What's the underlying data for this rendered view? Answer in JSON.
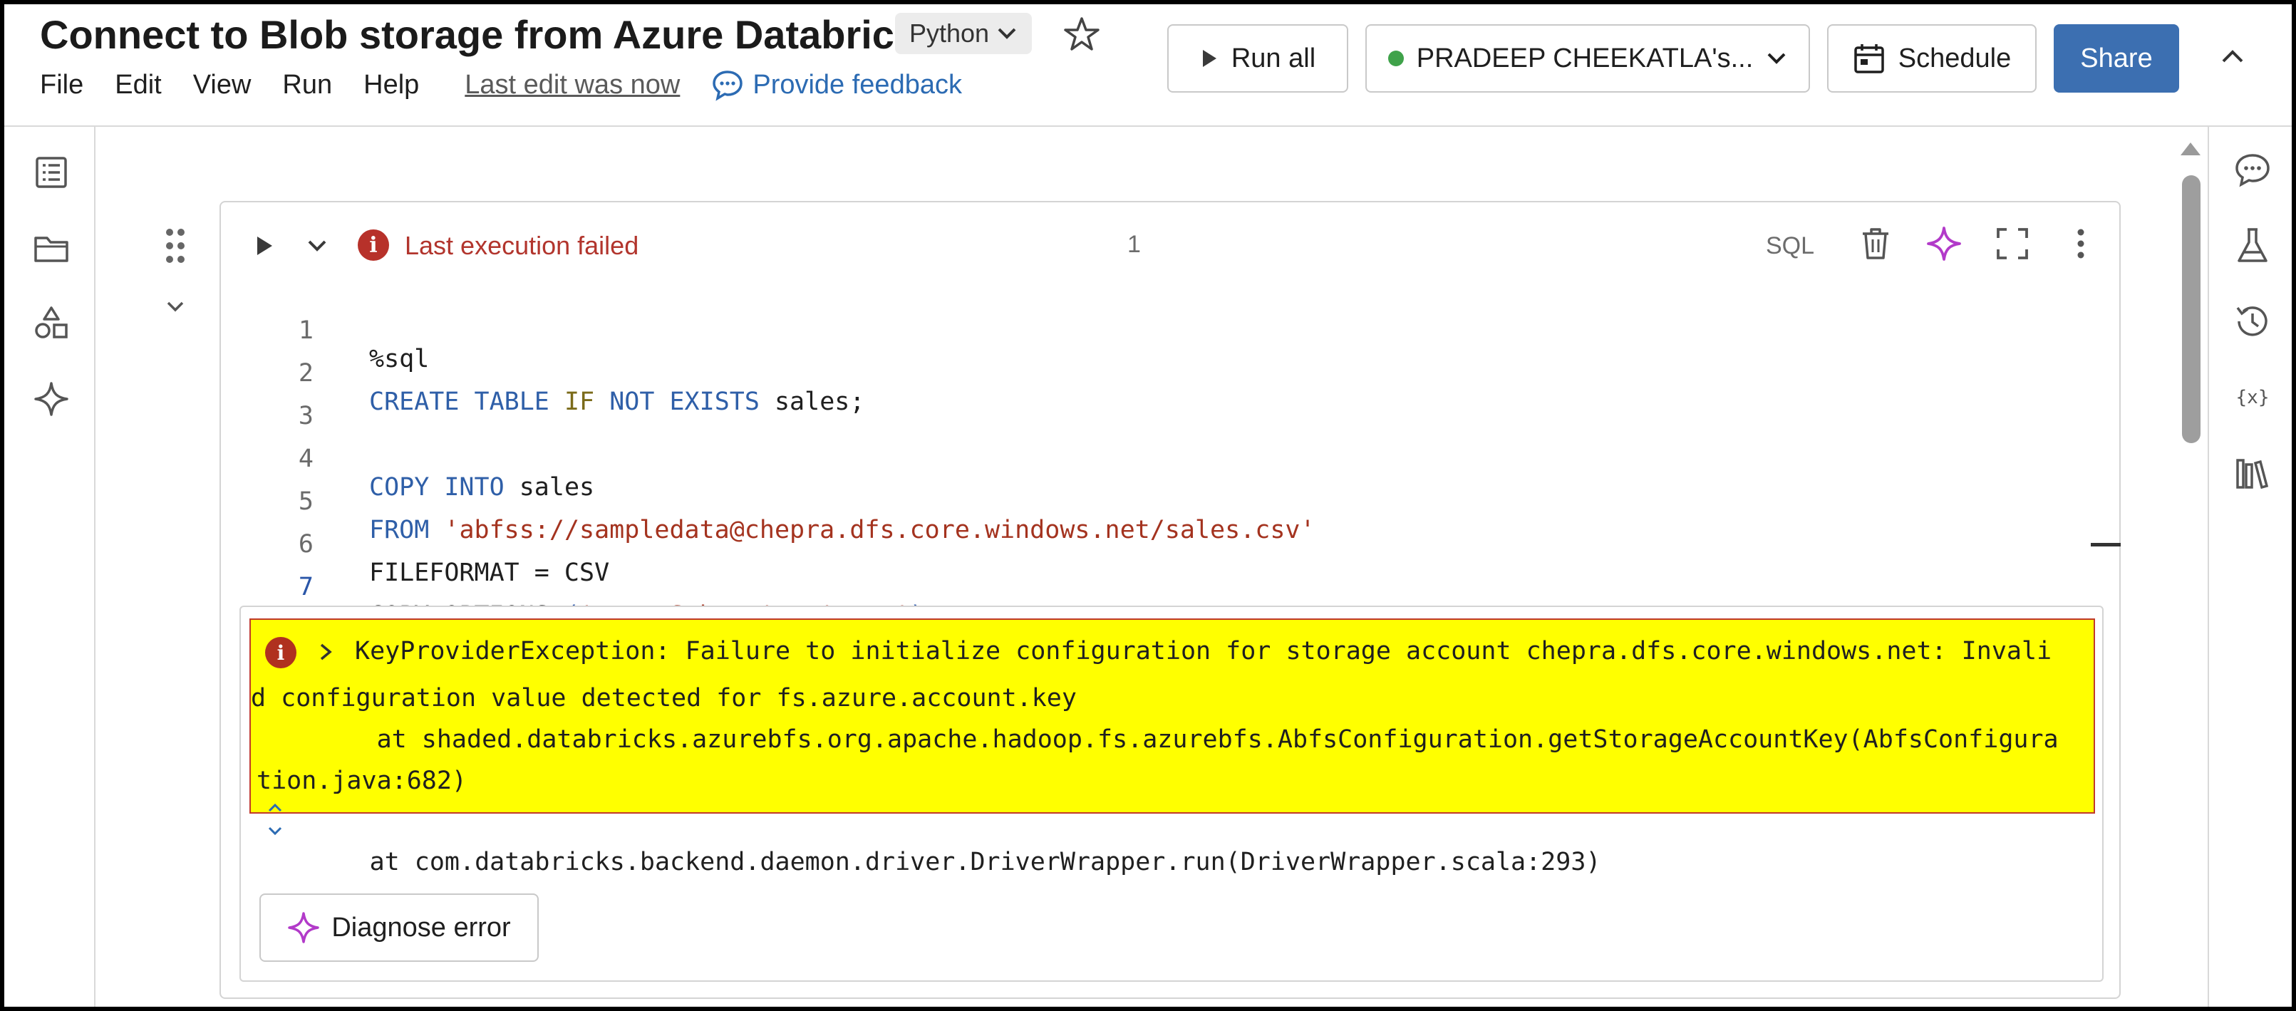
{
  "notebook": {
    "title": "Connect to Blob storage from Azure Databric...",
    "language": "Python"
  },
  "menu": {
    "file": "File",
    "edit": "Edit",
    "view": "View",
    "run": "Run",
    "help": "Help",
    "last_edit": "Last edit was now",
    "feedback": "Provide feedback"
  },
  "toolbar": {
    "run_all": "Run all",
    "cluster": "PRADEEP CHEEKATLA's...",
    "schedule": "Schedule",
    "share": "Share"
  },
  "cell": {
    "status": "Last execution failed",
    "execution_count": "1",
    "language": "SQL",
    "code_lines": [
      {
        "num": "1",
        "text": "%sql"
      },
      {
        "num": "2",
        "text": "CREATE TABLE IF NOT EXISTS sales;"
      },
      {
        "num": "3",
        "text": ""
      },
      {
        "num": "4",
        "text": "COPY INTO sales"
      },
      {
        "num": "5",
        "text": "FROM 'abfss://sampledata@chepra.dfs.core.windows.net/sales.csv'"
      },
      {
        "num": "6",
        "text": "FILEFORMAT = CSV"
      },
      {
        "num": "7",
        "text": "COPY_OPTIONS ('mergeSchema' = 'true');"
      }
    ]
  },
  "output": {
    "error_line1": "KeyProviderException: Failure to initialize configuration for storage account chepra.dfs.core.windows.net: Invali",
    "error_line2": "d configuration value detected for fs.azure.account.key",
    "error_line3": "        at shaded.databricks.azurebfs.org.apache.hadoop.fs.azurebfs.AbfsConfiguration.getStorageAccountKey(AbfsConfigura",
    "error_line4": "tion.java:682)",
    "trace_line": "        at com.databricks.backend.daemon.driver.DriverWrapper.run(DriverWrapper.scala:293)",
    "diagnose_label": "Diagnose error",
    "highlight_color": "#ffff00",
    "error_color": "#b2352d"
  },
  "colors": {
    "share_bg": "#3c6fb1",
    "cluster_status": "#3fa24a",
    "ai_sparkle": "#b23ac9"
  }
}
